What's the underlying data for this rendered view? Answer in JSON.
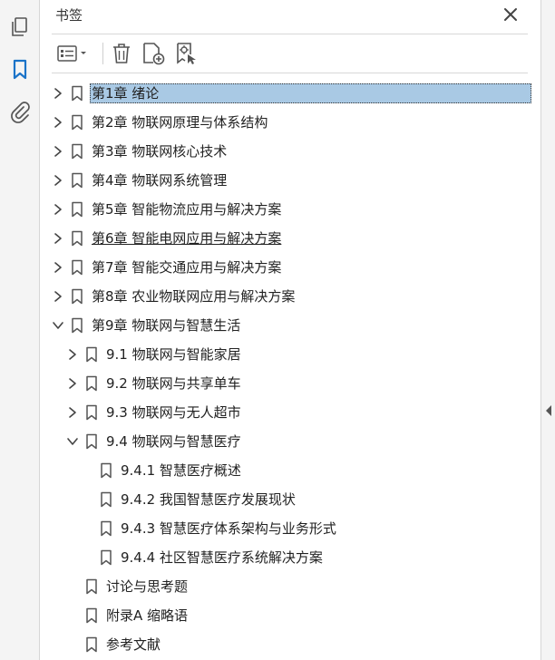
{
  "panel": {
    "title": "书签"
  },
  "rail": {
    "icons": [
      "pages-icon",
      "bookmark-icon",
      "attachment-icon"
    ]
  },
  "toolbar": {
    "buttons": [
      "options-menu",
      "delete-bookmark",
      "new-bookmark",
      "new-bookmark-from-structure"
    ]
  },
  "colors": {
    "selection": "#a9c9e4",
    "accent": "#1a73c8"
  },
  "tree": [
    {
      "label": "第1章 绪论",
      "level": 0,
      "state": "collapsed",
      "selected": true
    },
    {
      "label": "第2章 物联网原理与体系结构",
      "level": 0,
      "state": "collapsed"
    },
    {
      "label": "第3章 物联网核心技术",
      "level": 0,
      "state": "collapsed"
    },
    {
      "label": "第4章 物联网系统管理",
      "level": 0,
      "state": "collapsed"
    },
    {
      "label": "第5章 智能物流应用与解决方案",
      "level": 0,
      "state": "collapsed"
    },
    {
      "label": "第6章 智能电网应用与解决方案",
      "level": 0,
      "state": "collapsed",
      "underline": true
    },
    {
      "label": "第7章 智能交通应用与解决方案",
      "level": 0,
      "state": "collapsed"
    },
    {
      "label": "第8章 农业物联网应用与解决方案",
      "level": 0,
      "state": "collapsed"
    },
    {
      "label": "第9章 物联网与智慧生活",
      "level": 0,
      "state": "expanded"
    },
    {
      "label": "9.1 物联网与智能家居",
      "level": 1,
      "state": "collapsed"
    },
    {
      "label": "9.2 物联网与共享单车",
      "level": 1,
      "state": "collapsed"
    },
    {
      "label": "9.3 物联网与无人超市",
      "level": 1,
      "state": "collapsed"
    },
    {
      "label": "9.4 物联网与智慧医疗",
      "level": 1,
      "state": "expanded"
    },
    {
      "label": "9.4.1 智慧医疗概述",
      "level": 2,
      "state": "leaf"
    },
    {
      "label": "9.4.2 我国智慧医疗发展现状",
      "level": 2,
      "state": "leaf"
    },
    {
      "label": "9.4.3 智慧医疗体系架构与业务形式",
      "level": 2,
      "state": "leaf"
    },
    {
      "label": "9.4.4 社区智慧医疗系统解决方案",
      "level": 2,
      "state": "leaf"
    },
    {
      "label": "讨论与思考题",
      "level": 1,
      "state": "leaf"
    },
    {
      "label": "附录A 缩略语",
      "level": 1,
      "state": "leaf"
    },
    {
      "label": "参考文献",
      "level": 1,
      "state": "leaf"
    }
  ]
}
